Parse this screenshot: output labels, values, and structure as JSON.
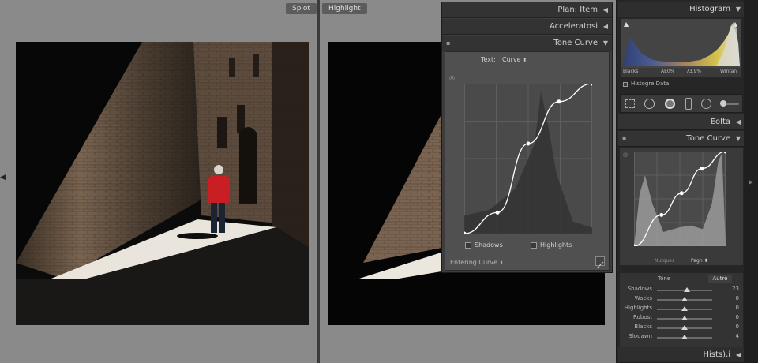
{
  "compare": {
    "left_label": "Splot",
    "right_label": "Highlight"
  },
  "float_panel": {
    "headers": [
      {
        "label": "Plan: Item"
      },
      {
        "label": "Acceleratosi"
      },
      {
        "label": "Tone Curve"
      }
    ],
    "text_label": "Text:",
    "channel_value": "Curve",
    "shadows_label": "Shadows",
    "highlights_label": "Highlights",
    "entering_curve": "Entering Curve",
    "curve_points": [
      [
        0.0,
        0.0
      ],
      [
        0.26,
        0.14
      ],
      [
        0.5,
        0.6
      ],
      [
        0.74,
        0.88
      ],
      [
        1.0,
        1.0
      ]
    ]
  },
  "sidebar": {
    "histogram": {
      "title": "Histogram",
      "labels": [
        "Blacks",
        "AE0%",
        "73.9%",
        "Wintan"
      ],
      "show_data_label": "Histogre Data"
    },
    "edit_label": "Eolta",
    "tone_curve": {
      "title": "Tone Curve",
      "channel_left": "Nutques",
      "channel_right": "Pagn",
      "curve_points": [
        [
          0.0,
          0.0
        ],
        [
          0.3,
          0.33
        ],
        [
          0.52,
          0.56
        ],
        [
          0.74,
          0.82
        ],
        [
          1.0,
          1.0
        ]
      ]
    },
    "tone_section": {
      "tone_label": "Tone",
      "auto_label": "Autre",
      "sliders": [
        {
          "name": "Shadows",
          "value": "23",
          "pos": 0.54
        },
        {
          "name": "Wacks",
          "value": "0",
          "pos": 0.5
        },
        {
          "name": "Highlights",
          "value": "0",
          "pos": 0.5
        },
        {
          "name": "Robost",
          "value": "0",
          "pos": 0.5
        },
        {
          "name": "Blacks",
          "value": "0",
          "pos": 0.5
        },
        {
          "name": "Slodawn",
          "value": "4",
          "pos": 0.5
        }
      ]
    },
    "bottom_label": "Hists),i"
  },
  "colors": {
    "viewer_bg": "#8a8a8a",
    "panel_bg": "#3d3d3d",
    "sidebar_bg": "#262626",
    "curve_line": "#ffffff"
  }
}
